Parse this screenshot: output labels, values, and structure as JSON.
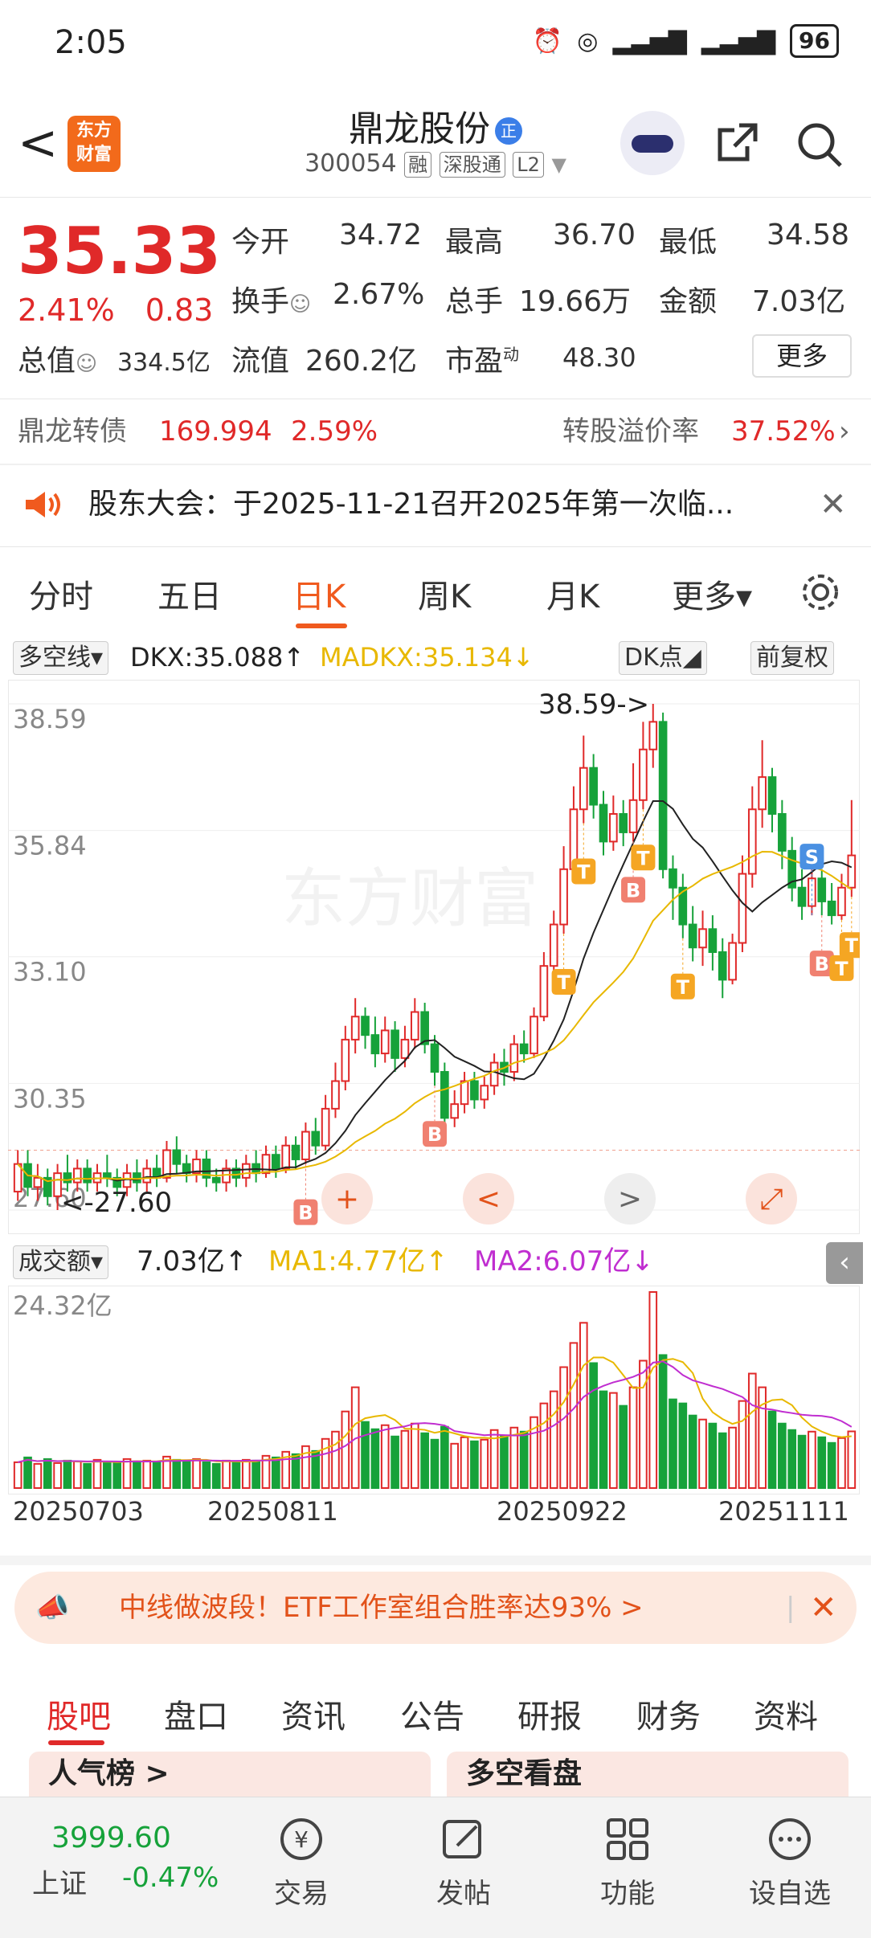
{
  "status_bar": {
    "time": "2:05",
    "battery": "96"
  },
  "header": {
    "back": "<",
    "logo_line1": "东方",
    "logo_line2": "财富",
    "stock_name": "鼎龙股份",
    "name_badge": "正",
    "code": "300054",
    "tags": [
      "融",
      "深股通",
      "L2"
    ]
  },
  "quote": {
    "price": "35.33",
    "change_pct": "2.41%",
    "change_amt": "0.83",
    "open_label": "今开",
    "open": "34.72",
    "high_label": "最高",
    "high": "36.70",
    "low_label": "最低",
    "low": "34.58",
    "turnover_label": "换手",
    "turnover": "2.67%",
    "volume_label": "总手",
    "volume": "19.66万",
    "amount_label": "金额",
    "amount": "7.03亿",
    "mktcap_label": "总值",
    "mktcap": "334.5亿",
    "float_label": "流值",
    "float": "260.2亿",
    "pe_label": "市盈",
    "pe_sup": "动",
    "pe": "48.30",
    "more": "更多"
  },
  "bond": {
    "name": "鼎龙转债",
    "price": "169.994",
    "pct": "2.59%",
    "premium_label": "转股溢价率",
    "premium": "37.52%"
  },
  "notice": {
    "text": "股东大会：于2025-11-21召开2025年第一次临..."
  },
  "tabs": {
    "items": [
      "分时",
      "五日",
      "日K",
      "周K",
      "月K",
      "更多▾"
    ],
    "active": "日K"
  },
  "indicator": {
    "select": "多空线▾",
    "dkx": "DKX:35.088↑",
    "madkx": "MADKX:35.134↓",
    "dk_btn": "DK点◢",
    "adj_btn": "前复权"
  },
  "chart_data": {
    "type": "candlestick",
    "y_ticks": [
      "38.59",
      "35.84",
      "33.10",
      "30.35",
      "27.60"
    ],
    "ylim": [
      27.6,
      38.59
    ],
    "high_marker": "38.59->",
    "low_marker": "<-27.60",
    "x_ticks": [
      "20250703",
      "20250811",
      "20250922",
      "20251111"
    ],
    "watermark": "东方财富",
    "candles": [
      [
        28.0,
        28.6,
        27.8,
        28.9
      ],
      [
        28.6,
        28.1,
        27.9,
        28.9
      ],
      [
        28.1,
        28.3,
        27.8,
        28.6
      ],
      [
        28.3,
        27.9,
        27.7,
        28.5
      ],
      [
        27.9,
        28.4,
        27.6,
        28.6
      ],
      [
        28.4,
        28.2,
        28.0,
        28.8
      ],
      [
        28.2,
        28.5,
        28.0,
        28.7
      ],
      [
        28.5,
        28.2,
        28.0,
        28.7
      ],
      [
        28.2,
        28.4,
        28.0,
        28.6
      ],
      [
        28.4,
        28.3,
        28.1,
        28.8
      ],
      [
        28.3,
        28.1,
        27.9,
        28.5
      ],
      [
        28.1,
        28.4,
        27.9,
        28.6
      ],
      [
        28.4,
        28.2,
        28.0,
        28.7
      ],
      [
        28.2,
        28.5,
        28.0,
        28.7
      ],
      [
        28.5,
        28.3,
        28.1,
        28.8
      ],
      [
        28.3,
        28.9,
        28.2,
        29.1
      ],
      [
        28.9,
        28.6,
        28.4,
        29.2
      ],
      [
        28.6,
        28.4,
        28.2,
        28.8
      ],
      [
        28.4,
        28.7,
        28.2,
        28.9
      ],
      [
        28.7,
        28.3,
        28.1,
        28.9
      ],
      [
        28.3,
        28.2,
        28.0,
        28.5
      ],
      [
        28.2,
        28.5,
        28.0,
        28.7
      ],
      [
        28.5,
        28.3,
        28.1,
        28.7
      ],
      [
        28.3,
        28.6,
        28.1,
        28.8
      ],
      [
        28.6,
        28.4,
        28.2,
        28.9
      ],
      [
        28.4,
        28.8,
        28.3,
        29.0
      ],
      [
        28.8,
        28.5,
        28.3,
        29.0
      ],
      [
        28.5,
        29.0,
        28.4,
        29.2
      ],
      [
        29.0,
        28.7,
        28.5,
        29.2
      ],
      [
        28.7,
        29.3,
        28.6,
        29.5
      ],
      [
        29.3,
        29.0,
        28.8,
        29.6
      ],
      [
        29.0,
        29.8,
        28.9,
        30.1
      ],
      [
        29.8,
        30.4,
        29.6,
        30.8
      ],
      [
        30.4,
        31.3,
        30.2,
        31.6
      ],
      [
        31.3,
        31.8,
        31.0,
        32.2
      ],
      [
        31.8,
        31.4,
        31.1,
        32.0
      ],
      [
        31.4,
        31.0,
        30.7,
        31.8
      ],
      [
        31.0,
        31.5,
        30.8,
        31.8
      ],
      [
        31.5,
        30.9,
        30.6,
        31.7
      ],
      [
        30.9,
        31.3,
        30.7,
        31.6
      ],
      [
        31.3,
        31.9,
        31.1,
        32.2
      ],
      [
        31.9,
        31.2,
        31.0,
        32.1
      ],
      [
        31.2,
        30.6,
        30.3,
        31.4
      ],
      [
        30.6,
        29.6,
        29.3,
        30.8
      ],
      [
        29.6,
        29.9,
        29.4,
        30.2
      ],
      [
        29.9,
        30.4,
        29.7,
        30.6
      ],
      [
        30.4,
        30.0,
        29.8,
        30.6
      ],
      [
        30.0,
        30.3,
        29.8,
        30.5
      ],
      [
        30.3,
        30.8,
        30.1,
        31.0
      ],
      [
        30.8,
        30.6,
        30.3,
        31.1
      ],
      [
        30.6,
        31.2,
        30.4,
        31.4
      ],
      [
        31.2,
        31.0,
        30.8,
        31.5
      ],
      [
        31.0,
        31.8,
        30.9,
        32.0
      ],
      [
        31.8,
        32.9,
        31.7,
        33.2
      ],
      [
        32.9,
        33.8,
        32.7,
        34.1
      ],
      [
        33.8,
        35.0,
        33.6,
        35.5
      ],
      [
        35.0,
        36.3,
        34.8,
        36.8
      ],
      [
        36.3,
        37.2,
        36.0,
        37.9
      ],
      [
        37.2,
        36.4,
        36.1,
        37.5
      ],
      [
        36.4,
        35.6,
        35.3,
        36.7
      ],
      [
        35.6,
        36.2,
        35.4,
        36.6
      ],
      [
        36.2,
        35.8,
        35.5,
        36.5
      ],
      [
        35.8,
        36.5,
        35.6,
        37.3
      ],
      [
        36.5,
        37.6,
        36.3,
        38.2
      ],
      [
        37.6,
        38.2,
        37.2,
        38.59
      ],
      [
        38.2,
        35.0,
        34.8,
        38.4
      ],
      [
        35.0,
        34.6,
        33.9,
        35.3
      ],
      [
        34.6,
        33.8,
        33.5,
        34.9
      ],
      [
        33.8,
        33.3,
        33.0,
        34.2
      ],
      [
        33.3,
        33.7,
        32.9,
        34.1
      ],
      [
        33.7,
        33.2,
        32.8,
        34.0
      ],
      [
        33.2,
        32.6,
        32.2,
        33.5
      ],
      [
        32.6,
        33.4,
        32.5,
        33.6
      ],
      [
        33.4,
        34.9,
        33.2,
        35.3
      ],
      [
        34.9,
        36.3,
        34.6,
        36.8
      ],
      [
        36.3,
        37.0,
        35.9,
        37.8
      ],
      [
        37.0,
        36.2,
        35.8,
        37.2
      ],
      [
        36.2,
        35.4,
        35.0,
        36.5
      ],
      [
        35.4,
        34.6,
        34.3,
        35.7
      ],
      [
        34.6,
        34.2,
        33.9,
        35.0
      ],
      [
        34.2,
        34.8,
        34.0,
        35.1
      ],
      [
        34.8,
        34.3,
        34.0,
        35.0
      ],
      [
        34.3,
        34.0,
        33.8,
        34.7
      ],
      [
        34.0,
        34.6,
        33.9,
        34.9
      ],
      [
        34.6,
        35.3,
        34.4,
        36.5
      ]
    ],
    "signals": [
      {
        "i": 29,
        "kind": "B"
      },
      {
        "i": 42,
        "kind": "B"
      },
      {
        "i": 55,
        "kind": "T"
      },
      {
        "i": 57,
        "kind": "T"
      },
      {
        "i": 62,
        "kind": "B"
      },
      {
        "i": 63,
        "kind": "T"
      },
      {
        "i": 67,
        "kind": "T"
      },
      {
        "i": 80,
        "kind": "S"
      },
      {
        "i": 81,
        "kind": "B"
      },
      {
        "i": 83,
        "kind": "T"
      },
      {
        "i": 84,
        "kind": "T"
      }
    ]
  },
  "chart_controls": {
    "plus": "+",
    "prev": "<",
    "next": ">"
  },
  "volume": {
    "select": "成交额▾",
    "value": "7.03亿↑",
    "ma1": "MA1:4.77亿↑",
    "ma2": "MA2:6.07亿↓",
    "max_label": "24.32亿",
    "values": [
      3.2,
      3.8,
      3.0,
      3.6,
      3.1,
      3.4,
      3.3,
      3.0,
      3.5,
      3.2,
      3.1,
      3.6,
      3.3,
      3.4,
      3.2,
      3.9,
      3.5,
      3.3,
      3.6,
      3.2,
      3.0,
      3.4,
      3.3,
      3.5,
      3.4,
      4.0,
      3.8,
      4.5,
      4.2,
      5.2,
      4.6,
      6.1,
      7.0,
      9.5,
      12.5,
      8.2,
      7.3,
      7.8,
      6.4,
      7.1,
      8.0,
      6.8,
      6.0,
      7.6,
      5.5,
      6.3,
      5.8,
      6.0,
      7.2,
      6.5,
      7.5,
      7.0,
      8.8,
      10.5,
      12.0,
      15.0,
      18.0,
      20.5,
      15.5,
      12.0,
      11.8,
      10.2,
      12.5,
      15.8,
      24.32,
      16.5,
      11.0,
      10.5,
      9.0,
      8.5,
      8.0,
      6.8,
      7.5,
      10.8,
      14.2,
      12.5,
      9.5,
      8.0,
      7.2,
      6.5,
      7.0,
      6.3,
      5.6,
      6.2,
      7.03
    ]
  },
  "banner": {
    "text": "中线做波段！ETF工作室组合胜率达93% >"
  },
  "bottom_tabs": [
    "股吧",
    "盘口",
    "资讯",
    "公告",
    "研报",
    "财务",
    "资料"
  ],
  "peek": {
    "left": "人气榜 >",
    "right": "多空看盘"
  },
  "bottom_nav": {
    "index_value": "3999.60",
    "index_name": "上证",
    "index_pct": "-0.47%",
    "items": [
      "交易",
      "发帖",
      "功能",
      "设自选"
    ]
  }
}
